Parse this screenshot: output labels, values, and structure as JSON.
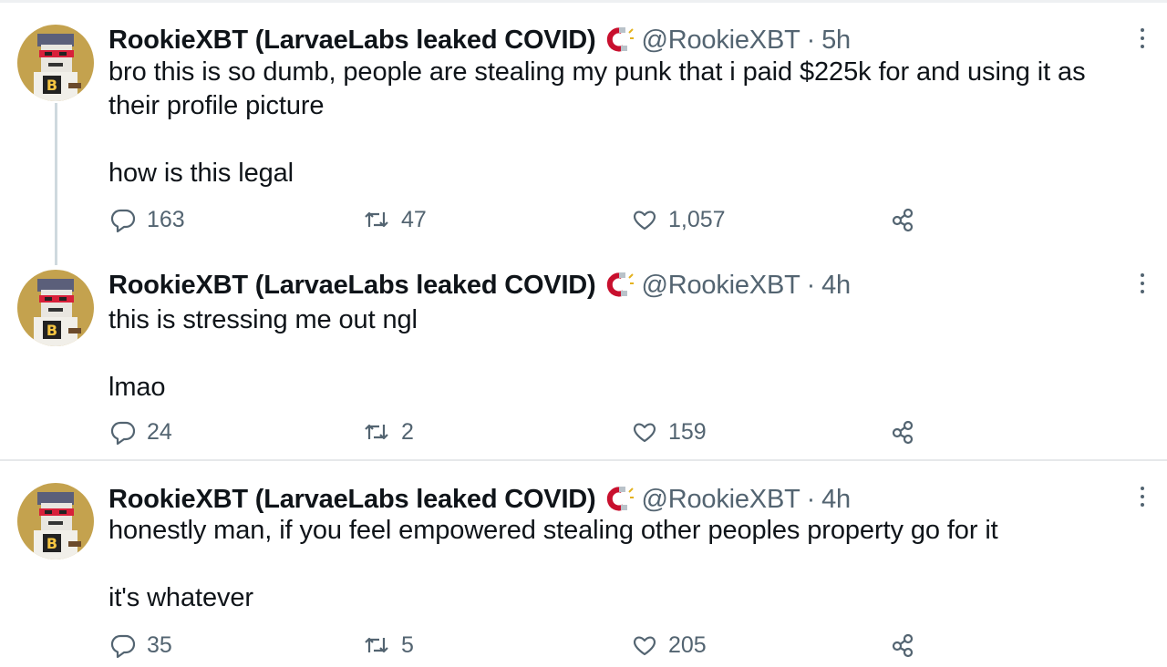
{
  "colors": {
    "text_primary": "#0f1419",
    "text_secondary": "#536471",
    "badge_red": "#c8102e",
    "divider": "#e6e8ea",
    "avatar_bg": "#c4a24e"
  },
  "tweets": [
    {
      "display_name": "RookieXBT (LarvaeLabs leaked COVID)",
      "badge_icon": "magnet-icon",
      "handle": "@RookieXBT",
      "separator": "·",
      "time": "5h",
      "text": "bro this is so dumb, people are stealing my punk that i paid $225k for and using it as\ntheir profile picture\n\nhow is this legal",
      "replies": "163",
      "retweets": "47",
      "likes": "1,057"
    },
    {
      "display_name": "RookieXBT (LarvaeLabs leaked COVID)",
      "badge_icon": "magnet-icon",
      "handle": "@RookieXBT",
      "separator": "·",
      "time": "4h",
      "text": "this is stressing me out ngl\n\nlmao",
      "replies": "24",
      "retweets": "2",
      "likes": "159"
    },
    {
      "display_name": "RookieXBT (LarvaeLabs leaked COVID)",
      "badge_icon": "magnet-icon",
      "handle": "@RookieXBT",
      "separator": "·",
      "time": "4h",
      "text": "honestly man, if you feel empowered stealing other peoples property go for it\n\nit's whatever",
      "replies": "35",
      "retweets": "5",
      "likes": "205"
    }
  ]
}
